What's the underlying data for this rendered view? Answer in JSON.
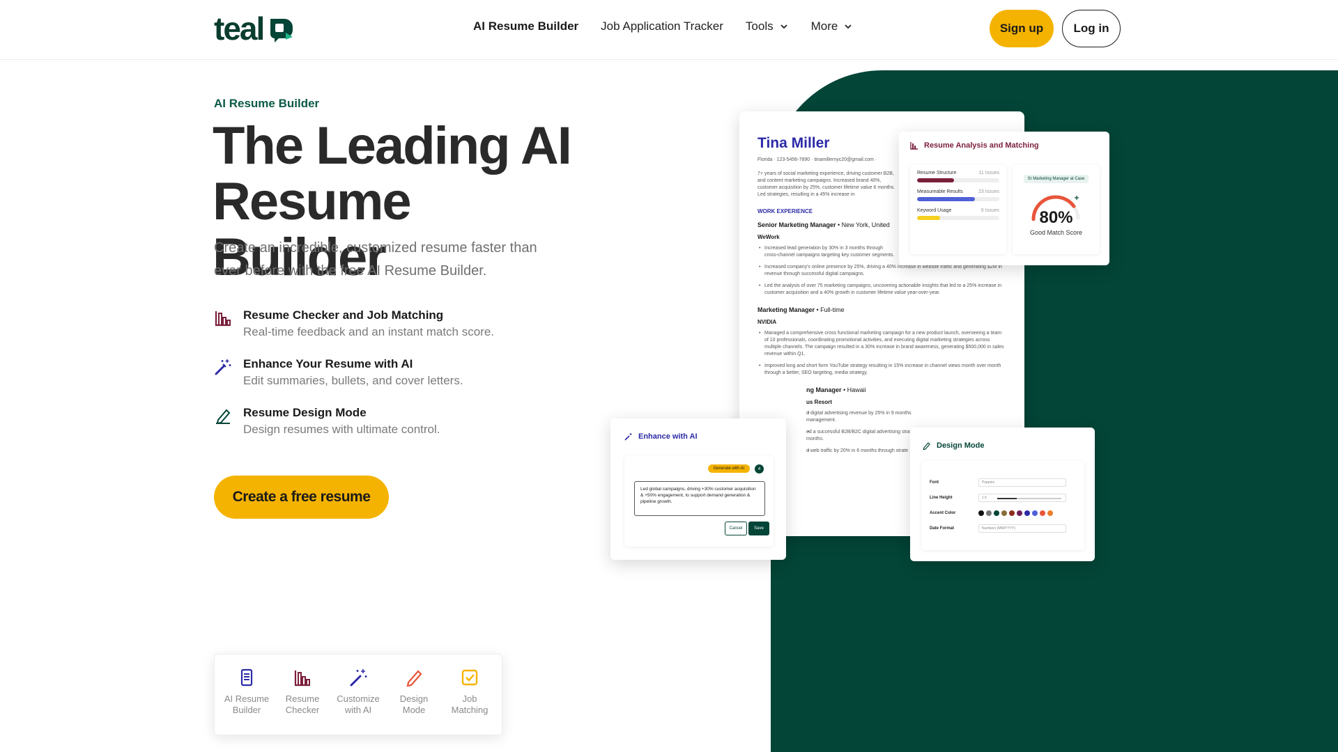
{
  "header": {
    "logo_text": "teal",
    "nav": [
      {
        "label": "AI Resume Builder",
        "bold": true
      },
      {
        "label": "Job Application Tracker",
        "bold": false
      },
      {
        "label": "Tools",
        "bold": false,
        "dropdown": true
      },
      {
        "label": "More",
        "bold": false,
        "dropdown": true
      }
    ],
    "signup_label": "Sign up",
    "login_label": "Log in"
  },
  "hero": {
    "eyebrow": "AI Resume Builder",
    "headline_line1": "The Leading AI",
    "headline_line2": "Resume Builder",
    "subtitle": "Create an incredible, customized resume faster than ever before with the free AI Resume Builder.",
    "features": [
      {
        "icon": "bar-chart-icon",
        "title": "Resume Checker and Job Matching",
        "desc": "Real-time feedback and an instant match score."
      },
      {
        "icon": "magic-wand-icon",
        "title": "Enhance Your Resume with AI",
        "desc": "Edit summaries, bullets, and cover letters."
      },
      {
        "icon": "pencil-icon",
        "title": "Resume Design Mode",
        "desc": "Design resumes with ultimate control."
      }
    ],
    "cta_label": "Create a free resume"
  },
  "tabbar": {
    "tabs": [
      {
        "icon": "document-icon",
        "label_l1": "AI Resume",
        "label_l2": "Builder",
        "color": "#2c2aa6"
      },
      {
        "icon": "bar-chart-icon",
        "label_l1": "Resume",
        "label_l2": "Checker",
        "color": "#7a1f3a"
      },
      {
        "icon": "magic-wand-icon",
        "label_l1": "Customize",
        "label_l2": "with AI",
        "color": "#2c2aa6"
      },
      {
        "icon": "pencil-icon",
        "label_l1": "Design",
        "label_l2": "Mode",
        "color": "#e8553a"
      },
      {
        "icon": "checkbox-icon",
        "label_l1": "Job",
        "label_l2": "Matching",
        "color": "#f5b301"
      }
    ]
  },
  "resume": {
    "name": "Tina Miller",
    "contact": "Florida · 123-5456-7890 · tinamillernyc20@gmail.com ·",
    "summary": "7+ years of social marketing experience, driving customer B2B, and content marketing campaigns. Increased brand 40%, customer acquisition by 25%, customer lifetime value 6 months. Led strategies, resulting in a 45% increase in",
    "section": "WORK EXPERIENCE",
    "jobs": [
      {
        "title": "Senior Marketing Manager",
        "detail": " • New York, United",
        "company": "WeWork",
        "bullets": [
          "Increased lead generation by 30% in 3 months through cross-channel campaigns targeting key customer segments.",
          "Increased company's online presence by 25%, driving a 40% increase in website traffic and generating $2M in revenue through successful digital campaigns.",
          "Led the analysis of over 75 marketing campaigns, uncovering actionable insights that led to a 25% increase in customer acquisition and a 40% growth in customer lifetime value year-over-year."
        ]
      },
      {
        "title": "Marketing Manager",
        "detail": " • Full-time",
        "company": "NVIDIA",
        "bullets": [
          "Managed a comprehensive cross functional marketing campaign for a new product launch, overseeing a team of 10 professionals, coordinating promotional activities, and executing digital marketing strategies across multiple channels. The campaign resulted in a 30% increase in brand awareness, generating $500,000 in sales revenue within Q1.",
          "Improved long and short form YouTube strategy resulting in 15% increase in channel views month over month through a better, SEO targeting, media strategy."
        ]
      },
      {
        "title": "ng Manager",
        "detail": " • Hawaii",
        "company": "us Resort",
        "bullets": [
          "d digital advertising revenue by 25% in 9 months management.",
          "ed a successful B2B/B2C digital advertising strat in 6 months.",
          "d web traffic by 20% in 6 months through strate"
        ]
      }
    ]
  },
  "analysis": {
    "title": "Resume Analysis and Matching",
    "rows": [
      {
        "label": "Resume Structure",
        "count": "11 Issues",
        "fill": 0.45,
        "color": "#7a1f3a"
      },
      {
        "label": "Measureable Results",
        "count": "23 Issues",
        "fill": 0.7,
        "color": "#5060d8"
      },
      {
        "label": "Keyword Usage",
        "count": "6 Issues",
        "fill": 0.28,
        "color": "#f5d020"
      }
    ],
    "job_pill": "Sr Marketing Manager at Case",
    "score": "80%",
    "score_fill": 0.8,
    "score_label": "Good Match Score"
  },
  "enhance": {
    "title": "Enhance with AI",
    "generate_label": "Generate with AI",
    "badge": "4",
    "text": "Led global campaigns, driving +30% customer acquisition & +50% engagement, to support demand generation & pipeline growth.",
    "cancel_label": "Cancel",
    "save_label": "Save"
  },
  "design": {
    "title": "Design Mode",
    "font_label": "Font",
    "font_value": "Poppins",
    "line_height_label": "Line Height",
    "line_height_value": "1.5",
    "line_height_fill": 0.3,
    "accent_label": "Accent Color",
    "accent_colors": [
      "#111111",
      "#777777",
      "#034537",
      "#8a6d3b",
      "#8b2c1f",
      "#6b1f5a",
      "#2c2aa6",
      "#5060d8",
      "#e8553a",
      "#f07c2a"
    ],
    "date_label": "Date Format",
    "date_value": "Numbers (MM/YYYY)"
  }
}
